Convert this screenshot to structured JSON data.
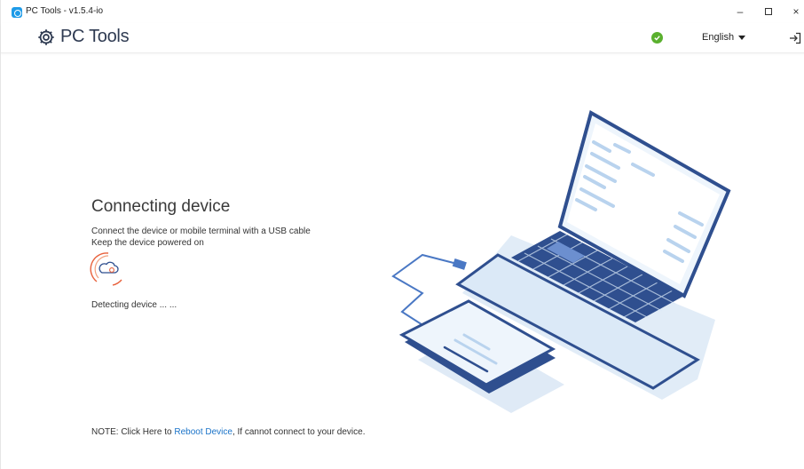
{
  "window": {
    "title": "PC Tools - v1.5.4-io",
    "minimize": "–",
    "close": "×"
  },
  "header": {
    "logo_text": "PC Tools",
    "language": "English",
    "status_color": "#5ab02e"
  },
  "main": {
    "heading": "Connecting device",
    "instruction_1": "Connect the device or mobile terminal with a USB cable",
    "instruction_2": "Keep the device powered on",
    "status": "Detecting device ... ...",
    "note_prefix": "NOTE: Click Here to ",
    "note_link": "Reboot Device",
    "note_suffix": ", If cannot connect to your device."
  },
  "icons": {
    "app": "app-logo-icon",
    "logo": "gear-icon",
    "status": "check-circle-icon",
    "exit": "exit-icon",
    "spinner": "cloud-sync-icon"
  },
  "colors": {
    "accent": "#1a73c8",
    "spinner": "#e8613c",
    "laptop_dark": "#2f4f8f",
    "laptop_light": "#dbe9f7"
  }
}
